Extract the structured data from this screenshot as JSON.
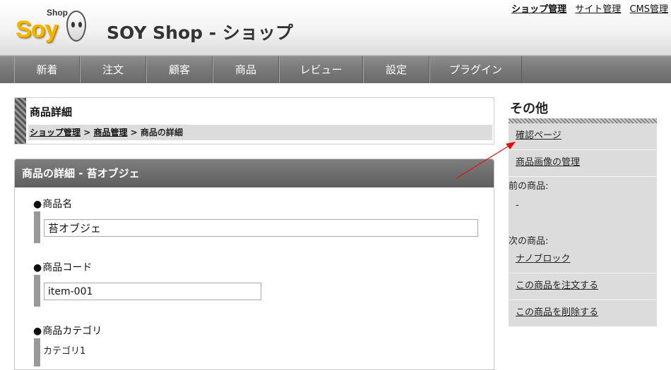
{
  "header": {
    "logo_small": "Shop",
    "logo_main": "Soy",
    "title": "SOY Shop - ショップ",
    "top_links": [
      "ショップ管理",
      "サイト管理",
      "CMS管理"
    ]
  },
  "nav": {
    "items": [
      "新着",
      "注文",
      "顧客",
      "商品",
      "レビュー",
      "設定",
      "プラグイン"
    ]
  },
  "page": {
    "heading": "商品詳細",
    "breadcrumb": [
      "ショップ管理",
      "商品管理",
      "商品の詳細"
    ],
    "breadcrumb_sep": ">"
  },
  "detail": {
    "header": "商品の詳細 - 苔オブジェ",
    "name_label": "商品名",
    "name_value": "苔オブジェ",
    "code_label": "商品コード",
    "code_value": "item-001",
    "category_label": "商品カテゴリ",
    "category_value": "カテゴリ1"
  },
  "sidebar": {
    "title": "その他",
    "confirm_link": "確認ページ",
    "image_link": "商品画像の管理",
    "prev_label": "前の商品:",
    "prev_value": "-",
    "next_label": "次の商品:",
    "next_link": "ナノブロック",
    "order_link": "この商品を注文する",
    "delete_link": "この商品を削除する"
  },
  "colors": {
    "logo_yellow": "#f2b500",
    "nav_bg": "#7a7a7a",
    "annotation_arrow": "#e01010"
  }
}
